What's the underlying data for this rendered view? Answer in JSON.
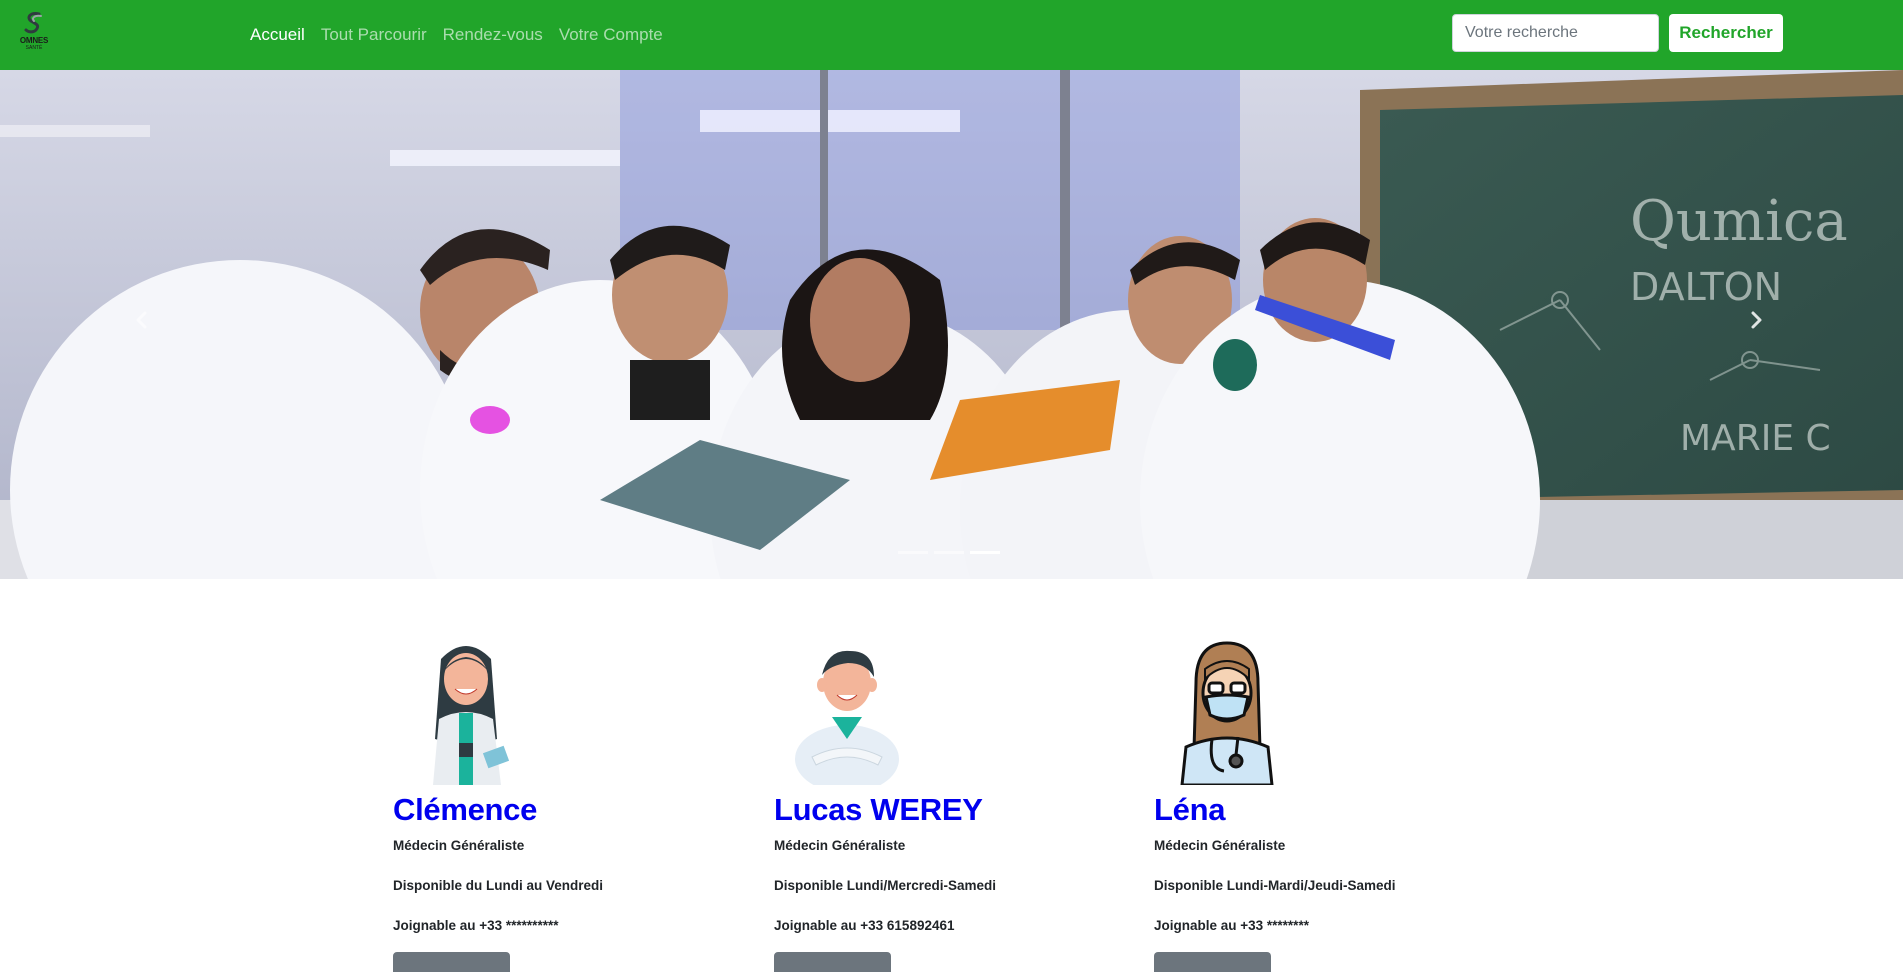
{
  "brand": {
    "logo_text": "OMNES",
    "logo_sub": "SANTÉ"
  },
  "nav": {
    "items": [
      {
        "label": "Accueil",
        "active": true
      },
      {
        "label": "Tout Parcourir",
        "active": false
      },
      {
        "label": "Rendez-vous",
        "active": false
      },
      {
        "label": "Votre Compte",
        "active": false
      }
    ]
  },
  "search": {
    "placeholder": "Votre recherche",
    "value": "",
    "button_label": "Rechercher"
  },
  "carousel": {
    "slide_count": 3,
    "active_index": 2,
    "chalkboard_lines": [
      "Qumica",
      "DALTON",
      "MARIE C"
    ],
    "prev_icon": "chevron-left-icon",
    "next_icon": "chevron-right-icon"
  },
  "doctors": [
    {
      "name": "Clémence",
      "specialty": "Médecin Généraliste",
      "availability": "Disponible du Lundi au Vendredi",
      "phone": "Joignable au +33 **********"
    },
    {
      "name": "Lucas WEREY",
      "specialty": "Médecin Généraliste",
      "availability": "Disponible Lundi/Mercredi-Samedi",
      "phone": "Joignable au +33 615892461"
    },
    {
      "name": "Léna",
      "specialty": "Médecin Généraliste",
      "availability": "Disponible Lundi-Mardi/Jeudi-Samedi",
      "phone": "Joignable au +33 ********"
    }
  ],
  "colors": {
    "nav_green": "#21a52a",
    "name_blue": "#0000ee",
    "button_gray": "#6c757d"
  }
}
